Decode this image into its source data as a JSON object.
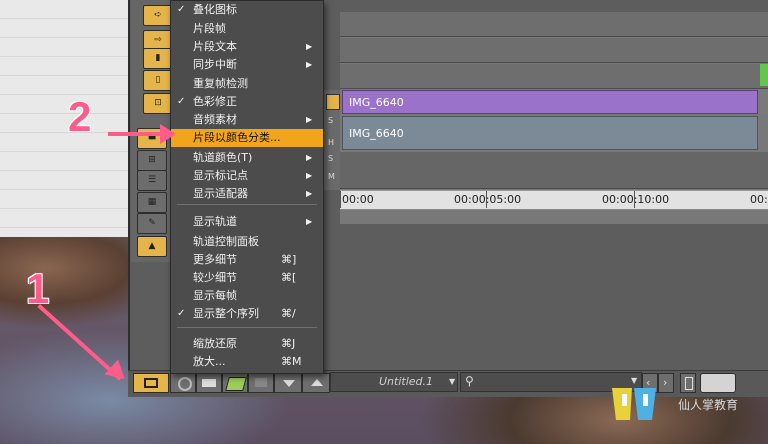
{
  "menu": {
    "items": [
      {
        "label": "叠化图标",
        "checked": true,
        "submenu": false,
        "shortcut": ""
      },
      {
        "label": "片段帧",
        "checked": false,
        "submenu": false,
        "shortcut": ""
      },
      {
        "label": "片段文本",
        "checked": false,
        "submenu": true,
        "shortcut": ""
      },
      {
        "label": "同步中断",
        "checked": false,
        "submenu": true,
        "shortcut": ""
      },
      {
        "label": "重复帧检测",
        "checked": false,
        "submenu": false,
        "shortcut": ""
      },
      {
        "label": "色彩修正",
        "checked": true,
        "submenu": false,
        "shortcut": ""
      },
      {
        "label": "音频素材",
        "checked": false,
        "submenu": true,
        "shortcut": ""
      },
      {
        "label": "片段以颜色分类...",
        "checked": false,
        "submenu": false,
        "shortcut": "",
        "highlighted": true
      },
      {
        "label": "轨道颜色(T)",
        "checked": false,
        "submenu": true,
        "shortcut": ""
      },
      {
        "label": "显示标记点",
        "checked": false,
        "submenu": true,
        "shortcut": ""
      },
      {
        "label": "显示适配器",
        "checked": false,
        "submenu": true,
        "shortcut": ""
      },
      {
        "label": "显示轨道",
        "checked": false,
        "submenu": true,
        "shortcut": ""
      },
      {
        "label": "轨道控制面板",
        "checked": false,
        "submenu": false,
        "shortcut": ""
      },
      {
        "label": "更多细节",
        "checked": false,
        "submenu": false,
        "shortcut": "⌘]"
      },
      {
        "label": "较少细节",
        "checked": false,
        "submenu": false,
        "shortcut": "⌘["
      },
      {
        "label": "显示每帧",
        "checked": false,
        "submenu": false,
        "shortcut": ""
      },
      {
        "label": "显示整个序列",
        "checked": true,
        "submenu": false,
        "shortcut": "⌘/"
      },
      {
        "label": "缩放还原",
        "checked": false,
        "submenu": false,
        "shortcut": "⌘J"
      },
      {
        "label": "放大...",
        "checked": false,
        "submenu": false,
        "shortcut": "⌘M"
      }
    ]
  },
  "timeline": {
    "clip_video": "IMG_6640",
    "clip_audio": "IMG_6640",
    "timecodes": [
      "00:00",
      "00:00:05:00",
      "00:00:10:00",
      "00:0"
    ],
    "track_letters": [
      "S",
      "H",
      "S",
      "M"
    ]
  },
  "bottombar": {
    "sequence_name": "Untitled.1"
  },
  "annotations": {
    "step1": "1",
    "step2": "2"
  },
  "watermark": "仙人掌教育",
  "colors": {
    "accent": "#f0a51a",
    "clip_video": "#9a72c9",
    "clip_audio": "#7b8a96",
    "annotation": "#ff5c8a"
  }
}
